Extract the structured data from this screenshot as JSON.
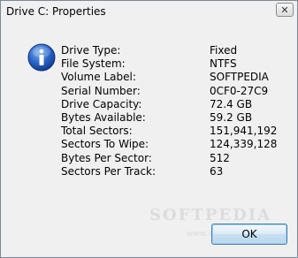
{
  "window": {
    "title": "Drive C: Properties",
    "close_label": "✕"
  },
  "icon": "info-icon",
  "properties": [
    {
      "label": "Drive Type:",
      "value": "Fixed"
    },
    {
      "label": "File System:",
      "value": "NTFS"
    },
    {
      "label": "Volume Label:",
      "value": "SOFTPEDIA"
    },
    {
      "label": "Serial Number:",
      "value": "0CF0-27C9"
    },
    {
      "label": "Drive Capacity:",
      "value": "72.4 GB"
    },
    {
      "label": "Bytes Available:",
      "value": "59.2 GB"
    },
    {
      "label": "Total Sectors:",
      "value": "151,941,192"
    },
    {
      "label": "Sectors To Wipe:",
      "value": "124,339,128"
    },
    {
      "label": "Bytes Per Sector:",
      "value": "512"
    },
    {
      "label": "Sectors Per Track:",
      "value": "63"
    }
  ],
  "watermark": {
    "text": "SOFTPEDIA",
    "sub": "www.softpedia.com"
  },
  "buttons": {
    "ok_label": "OK"
  }
}
